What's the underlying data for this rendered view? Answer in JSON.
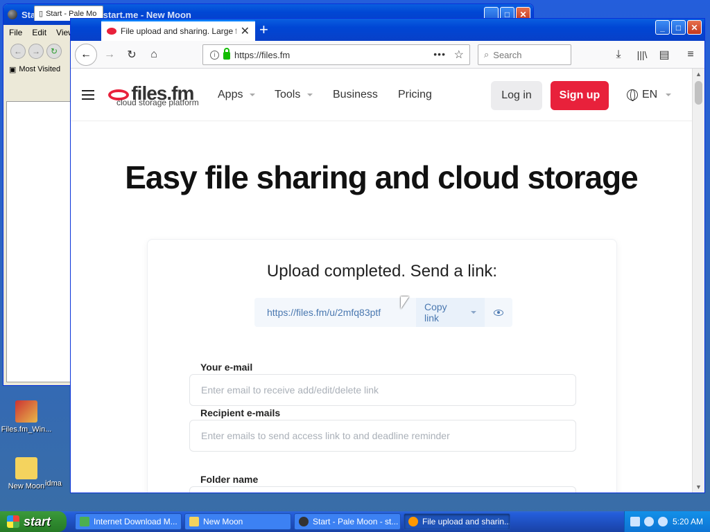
{
  "background_window": {
    "title": "Start - Pale Moon - start.me - New Moon",
    "menu": [
      "File",
      "Edit",
      "View"
    ],
    "bookmark": "Most Visited",
    "tab_label": "Start - Pale Mo"
  },
  "desktop_icons": [
    {
      "label": "Files.fm_Win..."
    },
    {
      "label": "New Moon"
    },
    {
      "label": "idma"
    }
  ],
  "browser": {
    "tab_title": "File upload and sharing. Large file",
    "new_tab_symbol": "+",
    "url": "https://files.fm",
    "url_more": "•••",
    "search_placeholder": "Search"
  },
  "site": {
    "logo_word": "files.fm",
    "logo_tagline": "cloud storage platform",
    "nav": [
      "Apps",
      "Tools",
      "Business",
      "Pricing"
    ],
    "login_label": "Log in",
    "signup_label": "Sign up",
    "language": "EN",
    "hero_title": "Easy file sharing and cloud storage",
    "upload": {
      "heading": "Upload completed. Send a link:",
      "link": "https://files.fm/u/2mfq83ptf",
      "copy_label": "Copy link"
    },
    "fields": [
      {
        "label": "Your e-mail",
        "placeholder": "Enter email to receive add/edit/delete link",
        "value": ""
      },
      {
        "label": "Recipient e-mails",
        "placeholder": "Enter emails to send access link to and deadline reminder",
        "value": ""
      },
      {
        "label": "Folder name",
        "placeholder": "",
        "value": ""
      }
    ]
  },
  "taskbar": {
    "start_label": "start",
    "tasks": [
      {
        "label": "Internet Download M..."
      },
      {
        "label": "New Moon"
      },
      {
        "label": "Start - Pale Moon - st..."
      },
      {
        "label": "File upload and sharin..."
      }
    ],
    "clock": "5:20 AM"
  },
  "colors": {
    "brand_red": "#e8213b",
    "link_blue": "#4a78b0",
    "xp_blue": "#245edb"
  }
}
